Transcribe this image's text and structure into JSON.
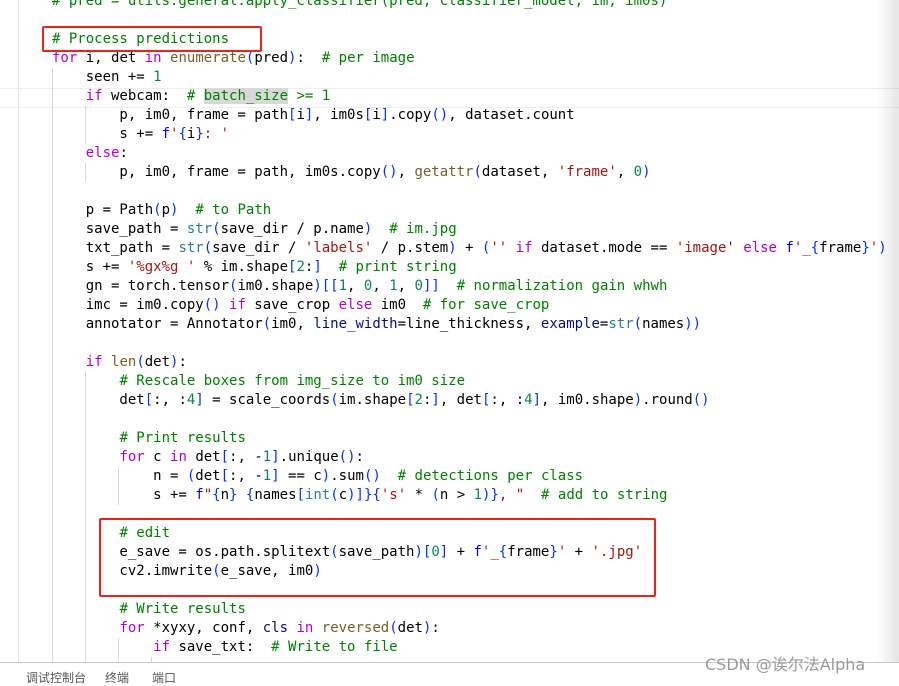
{
  "editor": {
    "lines": [
      [
        [
          "c",
          "# pred = utils.general.apply_classifier(pred, classifier_model, im, im0s)"
        ]
      ],
      [],
      [
        [
          "c",
          "# Process predictions"
        ]
      ],
      [
        [
          "k",
          "for"
        ],
        [
          "",
          " i, det "
        ],
        [
          "k",
          "in"
        ],
        [
          "",
          " "
        ],
        [
          "f",
          "enumerate"
        ],
        [
          "b",
          "("
        ],
        [
          "",
          "pred"
        ],
        [
          "b",
          ")"
        ],
        [
          "",
          ":  "
        ],
        [
          "c",
          "# per image"
        ]
      ],
      [
        [
          "",
          "    seen += "
        ],
        [
          "n",
          "1"
        ]
      ],
      [
        [
          "",
          "    "
        ],
        [
          "k",
          "if"
        ],
        [
          "",
          " webcam:  "
        ],
        [
          "c",
          "# "
        ],
        [
          "hl",
          "batch_size"
        ],
        [
          "c",
          " >= 1"
        ]
      ],
      [
        [
          "",
          "        p, im0, frame = path"
        ],
        [
          "b",
          "["
        ],
        [
          "",
          "i"
        ],
        [
          "b",
          "]"
        ],
        [
          "",
          ", im0s"
        ],
        [
          "b",
          "["
        ],
        [
          "",
          "i"
        ],
        [
          "b",
          "]"
        ],
        [
          "",
          ".copy"
        ],
        [
          "b",
          "()"
        ],
        [
          "",
          ", dataset.count"
        ]
      ],
      [
        [
          "",
          "        s += "
        ],
        [
          "fs",
          "f"
        ],
        [
          "s",
          "'"
        ],
        [
          "b",
          "{"
        ],
        [
          "",
          "i"
        ],
        [
          "b",
          "}"
        ],
        [
          "s",
          ": '"
        ]
      ],
      [
        [
          "",
          "    "
        ],
        [
          "k",
          "else"
        ],
        [
          "",
          ":"
        ]
      ],
      [
        [
          "",
          "        p, im0, frame = path, im0s.copy"
        ],
        [
          "b",
          "()"
        ],
        [
          "",
          ", "
        ],
        [
          "f",
          "getattr"
        ],
        [
          "b",
          "("
        ],
        [
          "",
          "dataset, "
        ],
        [
          "s",
          "'frame'"
        ],
        [
          "",
          ", "
        ],
        [
          "n",
          "0"
        ],
        [
          "b",
          ")"
        ]
      ],
      [],
      [
        [
          "",
          "    p = Path"
        ],
        [
          "b",
          "("
        ],
        [
          "",
          "p"
        ],
        [
          "b",
          ")"
        ],
        [
          "",
          "  "
        ],
        [
          "c",
          "# to Path"
        ]
      ],
      [
        [
          "",
          "    save_path = "
        ],
        [
          "t",
          "str"
        ],
        [
          "b",
          "("
        ],
        [
          "",
          "save_dir / p.name"
        ],
        [
          "b",
          ")"
        ],
        [
          "",
          "  "
        ],
        [
          "c",
          "# im.jpg"
        ]
      ],
      [
        [
          "",
          "    txt_path = "
        ],
        [
          "t",
          "str"
        ],
        [
          "b",
          "("
        ],
        [
          "",
          "save_dir / "
        ],
        [
          "s",
          "'labels'"
        ],
        [
          "",
          " / p.stem"
        ],
        [
          "b",
          ")"
        ],
        [
          "",
          " + "
        ],
        [
          "b",
          "("
        ],
        [
          "s",
          "''"
        ],
        [
          "",
          " "
        ],
        [
          "k",
          "if"
        ],
        [
          "",
          " dataset.mode == "
        ],
        [
          "s",
          "'image'"
        ],
        [
          "",
          " "
        ],
        [
          "k",
          "else"
        ],
        [
          "",
          " "
        ],
        [
          "fs",
          "f"
        ],
        [
          "s",
          "'_"
        ],
        [
          "b",
          "{"
        ],
        [
          "",
          "frame"
        ],
        [
          "b",
          "}"
        ],
        [
          "s",
          "'"
        ],
        [
          "b",
          ")"
        ]
      ],
      [
        [
          "",
          "    s += "
        ],
        [
          "s",
          "'%gx%g '"
        ],
        [
          "",
          " % im.shape"
        ],
        [
          "b",
          "["
        ],
        [
          "n",
          "2"
        ],
        [
          "",
          ":"
        ],
        [
          "b",
          "]"
        ],
        [
          "",
          "  "
        ],
        [
          "c",
          "# print string"
        ]
      ],
      [
        [
          "",
          "    gn = torch.tensor"
        ],
        [
          "b",
          "("
        ],
        [
          "",
          "im0.shape"
        ],
        [
          "b",
          ")[["
        ],
        [
          "n",
          "1"
        ],
        [
          "",
          ", "
        ],
        [
          "n",
          "0"
        ],
        [
          "",
          ", "
        ],
        [
          "n",
          "1"
        ],
        [
          "",
          ", "
        ],
        [
          "n",
          "0"
        ],
        [
          "b",
          "]]"
        ],
        [
          "",
          "  "
        ],
        [
          "c",
          "# normalization gain whwh"
        ]
      ],
      [
        [
          "",
          "    imc = im0.copy"
        ],
        [
          "b",
          "()"
        ],
        [
          "",
          " "
        ],
        [
          "k",
          "if"
        ],
        [
          "",
          " save_crop "
        ],
        [
          "k",
          "else"
        ],
        [
          "",
          " im0  "
        ],
        [
          "c",
          "# for save_crop"
        ]
      ],
      [
        [
          "",
          "    annotator = Annotator"
        ],
        [
          "b",
          "("
        ],
        [
          "",
          "im0, "
        ],
        [
          "p",
          "line_width"
        ],
        [
          "",
          "=line_thickness, "
        ],
        [
          "p",
          "example"
        ],
        [
          "",
          "="
        ],
        [
          "t",
          "str"
        ],
        [
          "b",
          "("
        ],
        [
          "",
          "names"
        ],
        [
          "b",
          "))"
        ]
      ],
      [],
      [
        [
          "",
          "    "
        ],
        [
          "k",
          "if"
        ],
        [
          "",
          " "
        ],
        [
          "f",
          "len"
        ],
        [
          "b",
          "("
        ],
        [
          "",
          "det"
        ],
        [
          "b",
          ")"
        ],
        [
          "",
          ":"
        ]
      ],
      [
        [
          "",
          "        "
        ],
        [
          "c",
          "# Rescale boxes from img_size to im0 size"
        ]
      ],
      [
        [
          "",
          "        det"
        ],
        [
          "b",
          "["
        ],
        [
          "",
          ":, :"
        ],
        [
          "n",
          "4"
        ],
        [
          "b",
          "]"
        ],
        [
          "",
          " = scale_coords"
        ],
        [
          "b",
          "("
        ],
        [
          "",
          "im.shape"
        ],
        [
          "b",
          "["
        ],
        [
          "n",
          "2"
        ],
        [
          "",
          ":"
        ],
        [
          "b",
          "]"
        ],
        [
          "",
          ", det"
        ],
        [
          "b",
          "["
        ],
        [
          "",
          ":, :"
        ],
        [
          "n",
          "4"
        ],
        [
          "b",
          "]"
        ],
        [
          "",
          ", im0.shape"
        ],
        [
          "b",
          ")"
        ],
        [
          "",
          ".round"
        ],
        [
          "b",
          "()"
        ]
      ],
      [],
      [
        [
          "",
          "        "
        ],
        [
          "c",
          "# Print results"
        ]
      ],
      [
        [
          "",
          "        "
        ],
        [
          "k",
          "for"
        ],
        [
          "",
          " c "
        ],
        [
          "k",
          "in"
        ],
        [
          "",
          " det"
        ],
        [
          "b",
          "["
        ],
        [
          "",
          ":, -"
        ],
        [
          "n",
          "1"
        ],
        [
          "b",
          "]"
        ],
        [
          "",
          ".unique"
        ],
        [
          "b",
          "()"
        ],
        [
          "",
          ":"
        ]
      ],
      [
        [
          "",
          "            n = "
        ],
        [
          "b",
          "("
        ],
        [
          "",
          "det"
        ],
        [
          "b",
          "["
        ],
        [
          "",
          ":, -"
        ],
        [
          "n",
          "1"
        ],
        [
          "b",
          "]"
        ],
        [
          "",
          " == c"
        ],
        [
          "b",
          ")"
        ],
        [
          "",
          ".sum"
        ],
        [
          "b",
          "()"
        ],
        [
          "",
          "  "
        ],
        [
          "c",
          "# detections per class"
        ]
      ],
      [
        [
          "",
          "            s += "
        ],
        [
          "fs",
          "f"
        ],
        [
          "s",
          "\""
        ],
        [
          "b",
          "{"
        ],
        [
          "",
          "n"
        ],
        [
          "b",
          "}"
        ],
        [
          "s",
          " "
        ],
        [
          "b",
          "{"
        ],
        [
          "",
          "names"
        ],
        [
          "b",
          "["
        ],
        [
          "t",
          "int"
        ],
        [
          "b",
          "("
        ],
        [
          "",
          "c"
        ],
        [
          "b",
          ")]}{"
        ],
        [
          "s",
          "'s'"
        ],
        [
          "",
          " * "
        ],
        [
          "b",
          "("
        ],
        [
          "",
          "n > "
        ],
        [
          "n",
          "1"
        ],
        [
          "b",
          ")}"
        ],
        [
          "s",
          ", \""
        ],
        [
          "",
          "  "
        ],
        [
          "c",
          "# add to string"
        ]
      ],
      [],
      [
        [
          "",
          "        "
        ],
        [
          "c",
          "# edit"
        ]
      ],
      [
        [
          "",
          "        e_save = os.path.splitext"
        ],
        [
          "b",
          "("
        ],
        [
          "",
          "save_path"
        ],
        [
          "b",
          ")["
        ],
        [
          "n",
          "0"
        ],
        [
          "b",
          "]"
        ],
        [
          "",
          " + "
        ],
        [
          "fs",
          "f"
        ],
        [
          "s",
          "'_"
        ],
        [
          "b",
          "{"
        ],
        [
          "",
          "frame"
        ],
        [
          "b",
          "}"
        ],
        [
          "s",
          "'"
        ],
        [
          "",
          " + "
        ],
        [
          "s",
          "'.jpg'"
        ]
      ],
      [
        [
          "",
          "        cv2.imwrite"
        ],
        [
          "b",
          "("
        ],
        [
          "",
          "e_save, im0"
        ],
        [
          "b",
          ")"
        ]
      ],
      [],
      [
        [
          "",
          "        "
        ],
        [
          "c",
          "# Write results"
        ]
      ],
      [
        [
          "",
          "        "
        ],
        [
          "k",
          "for"
        ],
        [
          "",
          " *xyxy, conf, "
        ],
        [
          "p",
          "cls"
        ],
        [
          "",
          " "
        ],
        [
          "k",
          "in"
        ],
        [
          "",
          " "
        ],
        [
          "f",
          "reversed"
        ],
        [
          "b",
          "("
        ],
        [
          "",
          "det"
        ],
        [
          "b",
          ")"
        ],
        [
          "",
          ":"
        ]
      ],
      [
        [
          "",
          "            "
        ],
        [
          "k",
          "if"
        ],
        [
          "",
          " save_txt:  "
        ],
        [
          "c",
          "# Write to file"
        ]
      ]
    ]
  },
  "panel": {
    "tabs": [
      "调试控制台",
      "终端",
      "端口"
    ]
  },
  "watermark": "CSDN @诶尔法Alpha",
  "colors": {
    "keyword": "#af00db",
    "function": "#795e26",
    "comment": "#008000",
    "string": "#a31515",
    "number": "#098658",
    "bracket": "#0431fa",
    "annotation_box": "#f0201a"
  }
}
